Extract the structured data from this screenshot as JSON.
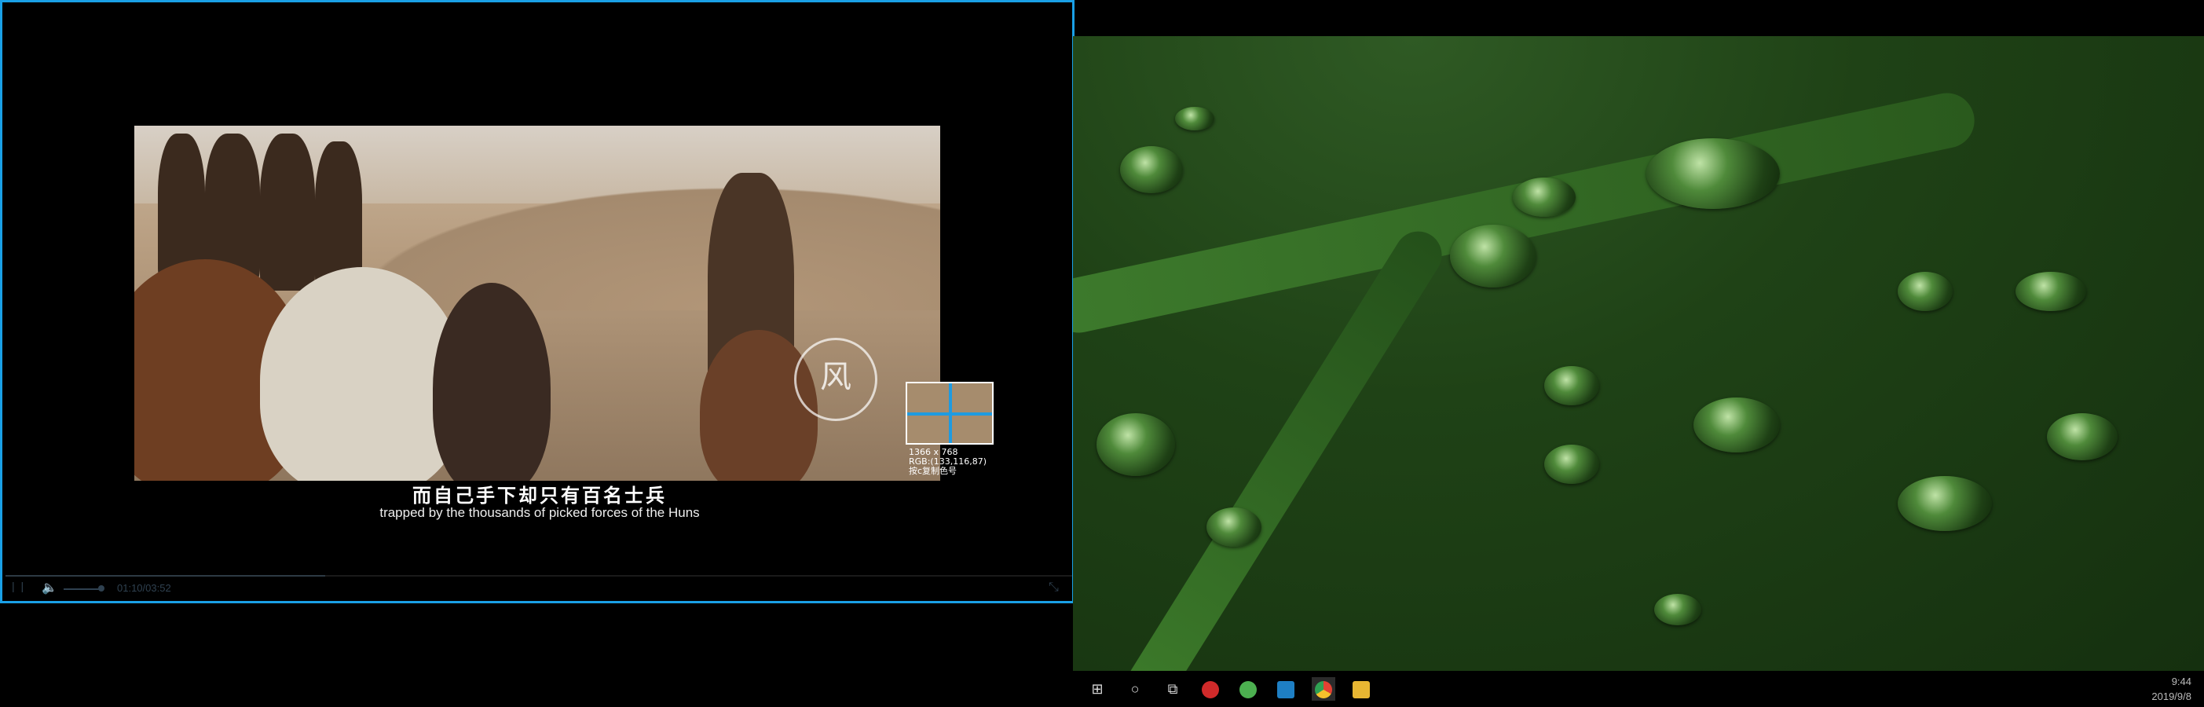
{
  "player": {
    "subtitle_cn": "而自己手下却只有百名士兵",
    "subtitle_en": "trapped by the thousands of picked forces of the Huns",
    "time_display": "01:10/03:52",
    "progress": 0.3
  },
  "color_picker": {
    "size": "1366 x 768",
    "rgb": "RGB:(133,116,87)",
    "hint": "按c复制色号"
  },
  "taskbar": {
    "time": "9:44",
    "date": "2019/9/8",
    "apps": [
      "start-icon",
      "cortana-icon",
      "task-view-icon",
      "netease-music-icon",
      "wechat-icon",
      "vscode-icon",
      "chrome-icon",
      "file-explorer-icon"
    ]
  },
  "colors": {
    "accent": "#1aa0e6",
    "leaf": "#1f4216"
  }
}
